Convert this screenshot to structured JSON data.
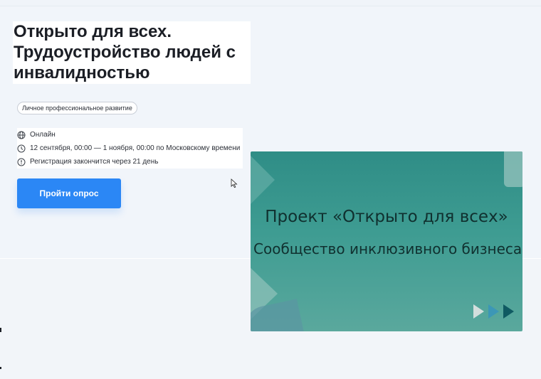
{
  "event": {
    "title": "Открыто для всех.\nТрудоустройство людей с\nинвалидностью",
    "tag": "Личное профессиональное развитие",
    "info": [
      {
        "icon": "globe-icon",
        "text": "Онлайн"
      },
      {
        "icon": "clock-icon",
        "text": "12 сентября, 00:00 — 1 ноября, 00:00 по Московскому времени"
      },
      {
        "icon": "alert-icon",
        "text": "Регистрация закончится через 21 день"
      }
    ],
    "cta_label": "Пройти опрос"
  },
  "banner": {
    "title": "Проект «Открыто для всех»",
    "subtitle": "Сообщество инклюзивного бизнеса"
  },
  "colors": {
    "accent": "#2b87f5",
    "banner_teal": "#3e9c92",
    "background": "#f0f4f9"
  }
}
